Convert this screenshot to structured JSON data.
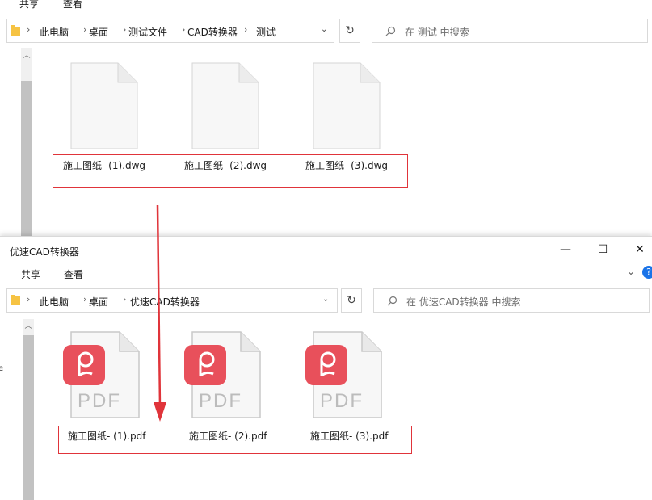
{
  "top_window": {
    "ribbon": [
      "共享",
      "查看"
    ],
    "breadcrumb": [
      "此电脑",
      "桌面",
      "测试文件",
      "CAD转换器",
      "测试"
    ],
    "search_placeholder": "在 测试 中搜索",
    "files": [
      "施工图纸- (1).dwg",
      "施工图纸- (2).dwg",
      "施工图纸- (3).dwg"
    ]
  },
  "bottom_window": {
    "title": "优速CAD转换器",
    "ribbon": [
      "共享",
      "查看"
    ],
    "breadcrumb": [
      "此电脑",
      "桌面",
      "优速CAD转换器"
    ],
    "search_placeholder": "在 优速CAD转换器 中搜索",
    "files": [
      "施工图纸- (1).pdf",
      "施工图纸- (2).pdf",
      "施工图纸- (3).pdf"
    ],
    "pdf_badge": "PDF"
  },
  "colors": {
    "highlight_box": "#e0343a",
    "arrow": "#e0343a",
    "pdf_red": "#e8505b",
    "help_blue": "#1a73e8"
  },
  "icons": [
    "chevron-up-icon",
    "folder-icon",
    "chevron-right-icon",
    "chevron-down-icon",
    "refresh-icon",
    "search-icon",
    "minimize-icon",
    "maximize-icon",
    "close-icon",
    "help-icon",
    "dwg-file-icon",
    "pdf-file-icon",
    "down-arrow-icon"
  ]
}
